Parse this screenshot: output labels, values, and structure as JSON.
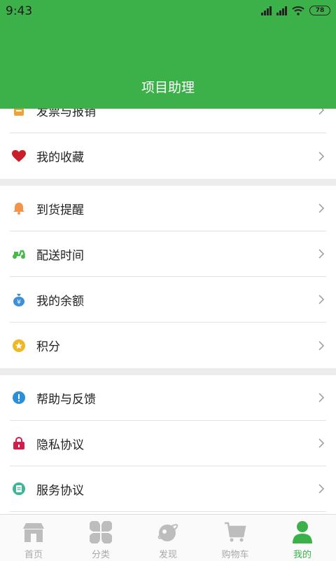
{
  "status_bar": {
    "time": "9:43",
    "battery": "78"
  },
  "header": {
    "title": "项目助理"
  },
  "list": [
    {
      "id": "invoice",
      "label": "发票与报销",
      "icon": "invoice-icon",
      "color": "#f0a23a"
    },
    {
      "id": "favorites",
      "label": "我的收藏",
      "icon": "heart-icon",
      "color": "#d8232a"
    },
    {
      "id": "restock",
      "label": "到货提醒",
      "icon": "bell-icon",
      "color": "#f2954a"
    },
    {
      "id": "delivery",
      "label": "配送时间",
      "icon": "scooter-icon",
      "color": "#47b949"
    },
    {
      "id": "balance",
      "label": "我的余额",
      "icon": "money-bag-icon",
      "color": "#3d8fd8"
    },
    {
      "id": "points",
      "label": "积分",
      "icon": "star-coin-icon",
      "color": "#f0b623"
    },
    {
      "id": "help",
      "label": "帮助与反馈",
      "icon": "help-icon",
      "color": "#2a8fd6"
    },
    {
      "id": "privacy",
      "label": "隐私协议",
      "icon": "lock-icon",
      "color": "#d21f4a"
    },
    {
      "id": "service",
      "label": "服务协议",
      "icon": "document-icon",
      "color": "#3fb598"
    }
  ],
  "tabbar": [
    {
      "id": "home",
      "label": "首页",
      "icon": "store-icon"
    },
    {
      "id": "category",
      "label": "分类",
      "icon": "grid-icon"
    },
    {
      "id": "discover",
      "label": "发现",
      "icon": "planet-icon"
    },
    {
      "id": "cart",
      "label": "购物车",
      "icon": "cart-icon"
    },
    {
      "id": "mine",
      "label": "我的",
      "icon": "user-icon",
      "active": true
    }
  ],
  "colors": {
    "brand": "#3cb14a",
    "tab_inactive": "#a9a9a9",
    "separator": "#ececec"
  }
}
